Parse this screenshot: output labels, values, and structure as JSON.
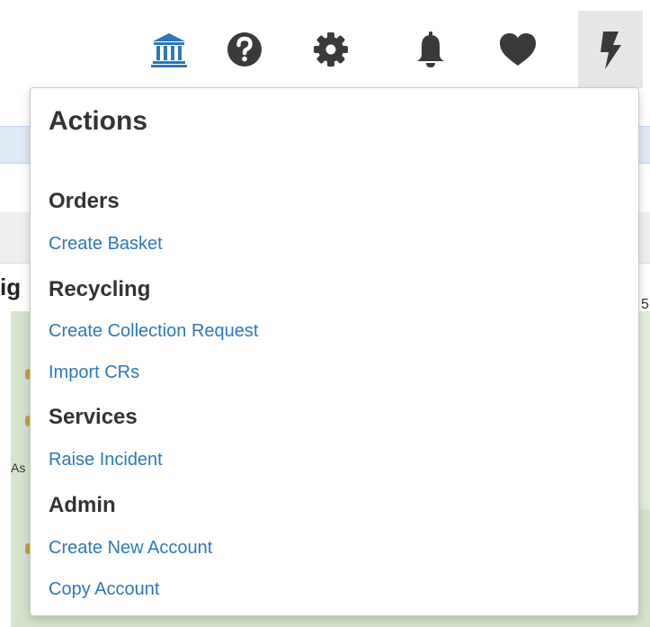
{
  "toolbar": {
    "icons": [
      "bank-icon",
      "help-icon",
      "gear-icon",
      "bell-icon",
      "heart-icon",
      "lightning-icon"
    ],
    "accent_color": "#2f78b7",
    "icon_color": "#3a3a3a"
  },
  "background": {
    "heading_fragment": "ig",
    "label_fragment": "As",
    "value_fragment": "5"
  },
  "menu": {
    "title": "Actions",
    "sections": [
      {
        "label": "Orders",
        "items": [
          "Create Basket"
        ]
      },
      {
        "label": "Recycling",
        "items": [
          "Create Collection Request",
          "Import CRs"
        ]
      },
      {
        "label": "Services",
        "items": [
          "Raise Incident"
        ]
      },
      {
        "label": "Admin",
        "items": [
          "Create New Account",
          "Copy Account"
        ]
      }
    ],
    "link_color": "#2f78b7"
  }
}
